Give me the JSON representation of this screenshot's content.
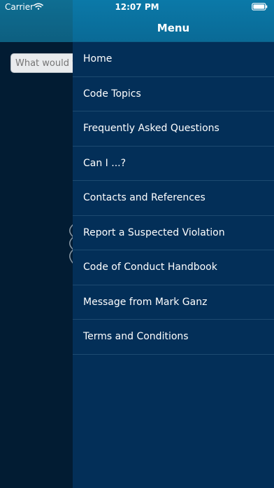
{
  "status_bar": {
    "carrier": "Carrier",
    "time": "12:07 PM"
  },
  "background_screen": {
    "search_placeholder": "What would you like to search?",
    "wave_icon": "wave-icon"
  },
  "drawer": {
    "title": "Menu",
    "items": [
      {
        "label": "Home"
      },
      {
        "label": "Code Topics"
      },
      {
        "label": "Frequently Asked Questions"
      },
      {
        "label": "Can I ...?"
      },
      {
        "label": "Contacts and References"
      },
      {
        "label": "Report a Suspected Violation"
      },
      {
        "label": "Code of Conduct Handbook"
      },
      {
        "label": "Message from Mark Ganz"
      },
      {
        "label": "Terms and Conditions"
      }
    ]
  },
  "colors": {
    "drawer_background": "#032f58",
    "drawer_header": "#0a6a96",
    "underlying_background": "#021c33",
    "separator": "#1d4a70",
    "text": "#ffffff"
  }
}
